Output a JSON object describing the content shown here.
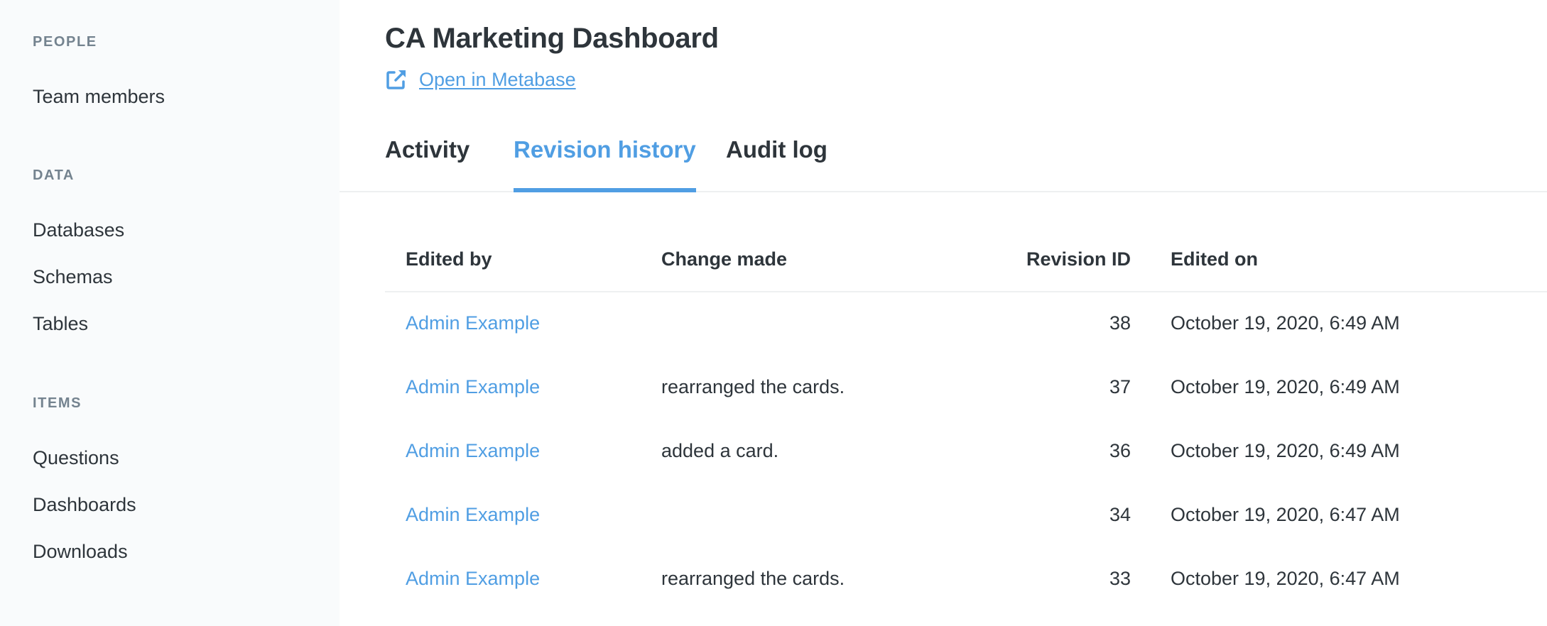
{
  "sidebar": {
    "sections": [
      {
        "heading": "PEOPLE",
        "items": [
          {
            "label": "Team members"
          }
        ]
      },
      {
        "heading": "DATA",
        "items": [
          {
            "label": "Databases"
          },
          {
            "label": "Schemas"
          },
          {
            "label": "Tables"
          }
        ]
      },
      {
        "heading": "ITEMS",
        "items": [
          {
            "label": "Questions"
          },
          {
            "label": "Dashboards"
          },
          {
            "label": "Downloads"
          }
        ]
      }
    ]
  },
  "header": {
    "title": "CA Marketing Dashboard",
    "open_link": {
      "label": "Open in Metabase",
      "icon": "external-link-icon"
    }
  },
  "tabs": [
    {
      "label": "Activity",
      "active": false
    },
    {
      "label": "Revision history",
      "active": true
    },
    {
      "label": "Audit log",
      "active": false
    }
  ],
  "table": {
    "columns": [
      "Edited by",
      "Change made",
      "Revision ID",
      "Edited on"
    ],
    "rows": [
      {
        "edited_by": "Admin Example",
        "change": "",
        "revision_id": "38",
        "edited_on": "October 19, 2020, 6:49 AM"
      },
      {
        "edited_by": "Admin Example",
        "change": "rearranged the cards.",
        "revision_id": "37",
        "edited_on": "October 19, 2020, 6:49 AM"
      },
      {
        "edited_by": "Admin Example",
        "change": "added a card.",
        "revision_id": "36",
        "edited_on": "October 19, 2020, 6:49 AM"
      },
      {
        "edited_by": "Admin Example",
        "change": "",
        "revision_id": "34",
        "edited_on": "October 19, 2020, 6:47 AM"
      },
      {
        "edited_by": "Admin Example",
        "change": "rearranged the cards.",
        "revision_id": "33",
        "edited_on": "October 19, 2020, 6:47 AM"
      }
    ]
  },
  "colors": {
    "accent": "#509ee3",
    "text": "#2e353b",
    "muted": "#74838f",
    "sidebar_bg": "#f9fbfc",
    "border": "#eef0f1"
  }
}
